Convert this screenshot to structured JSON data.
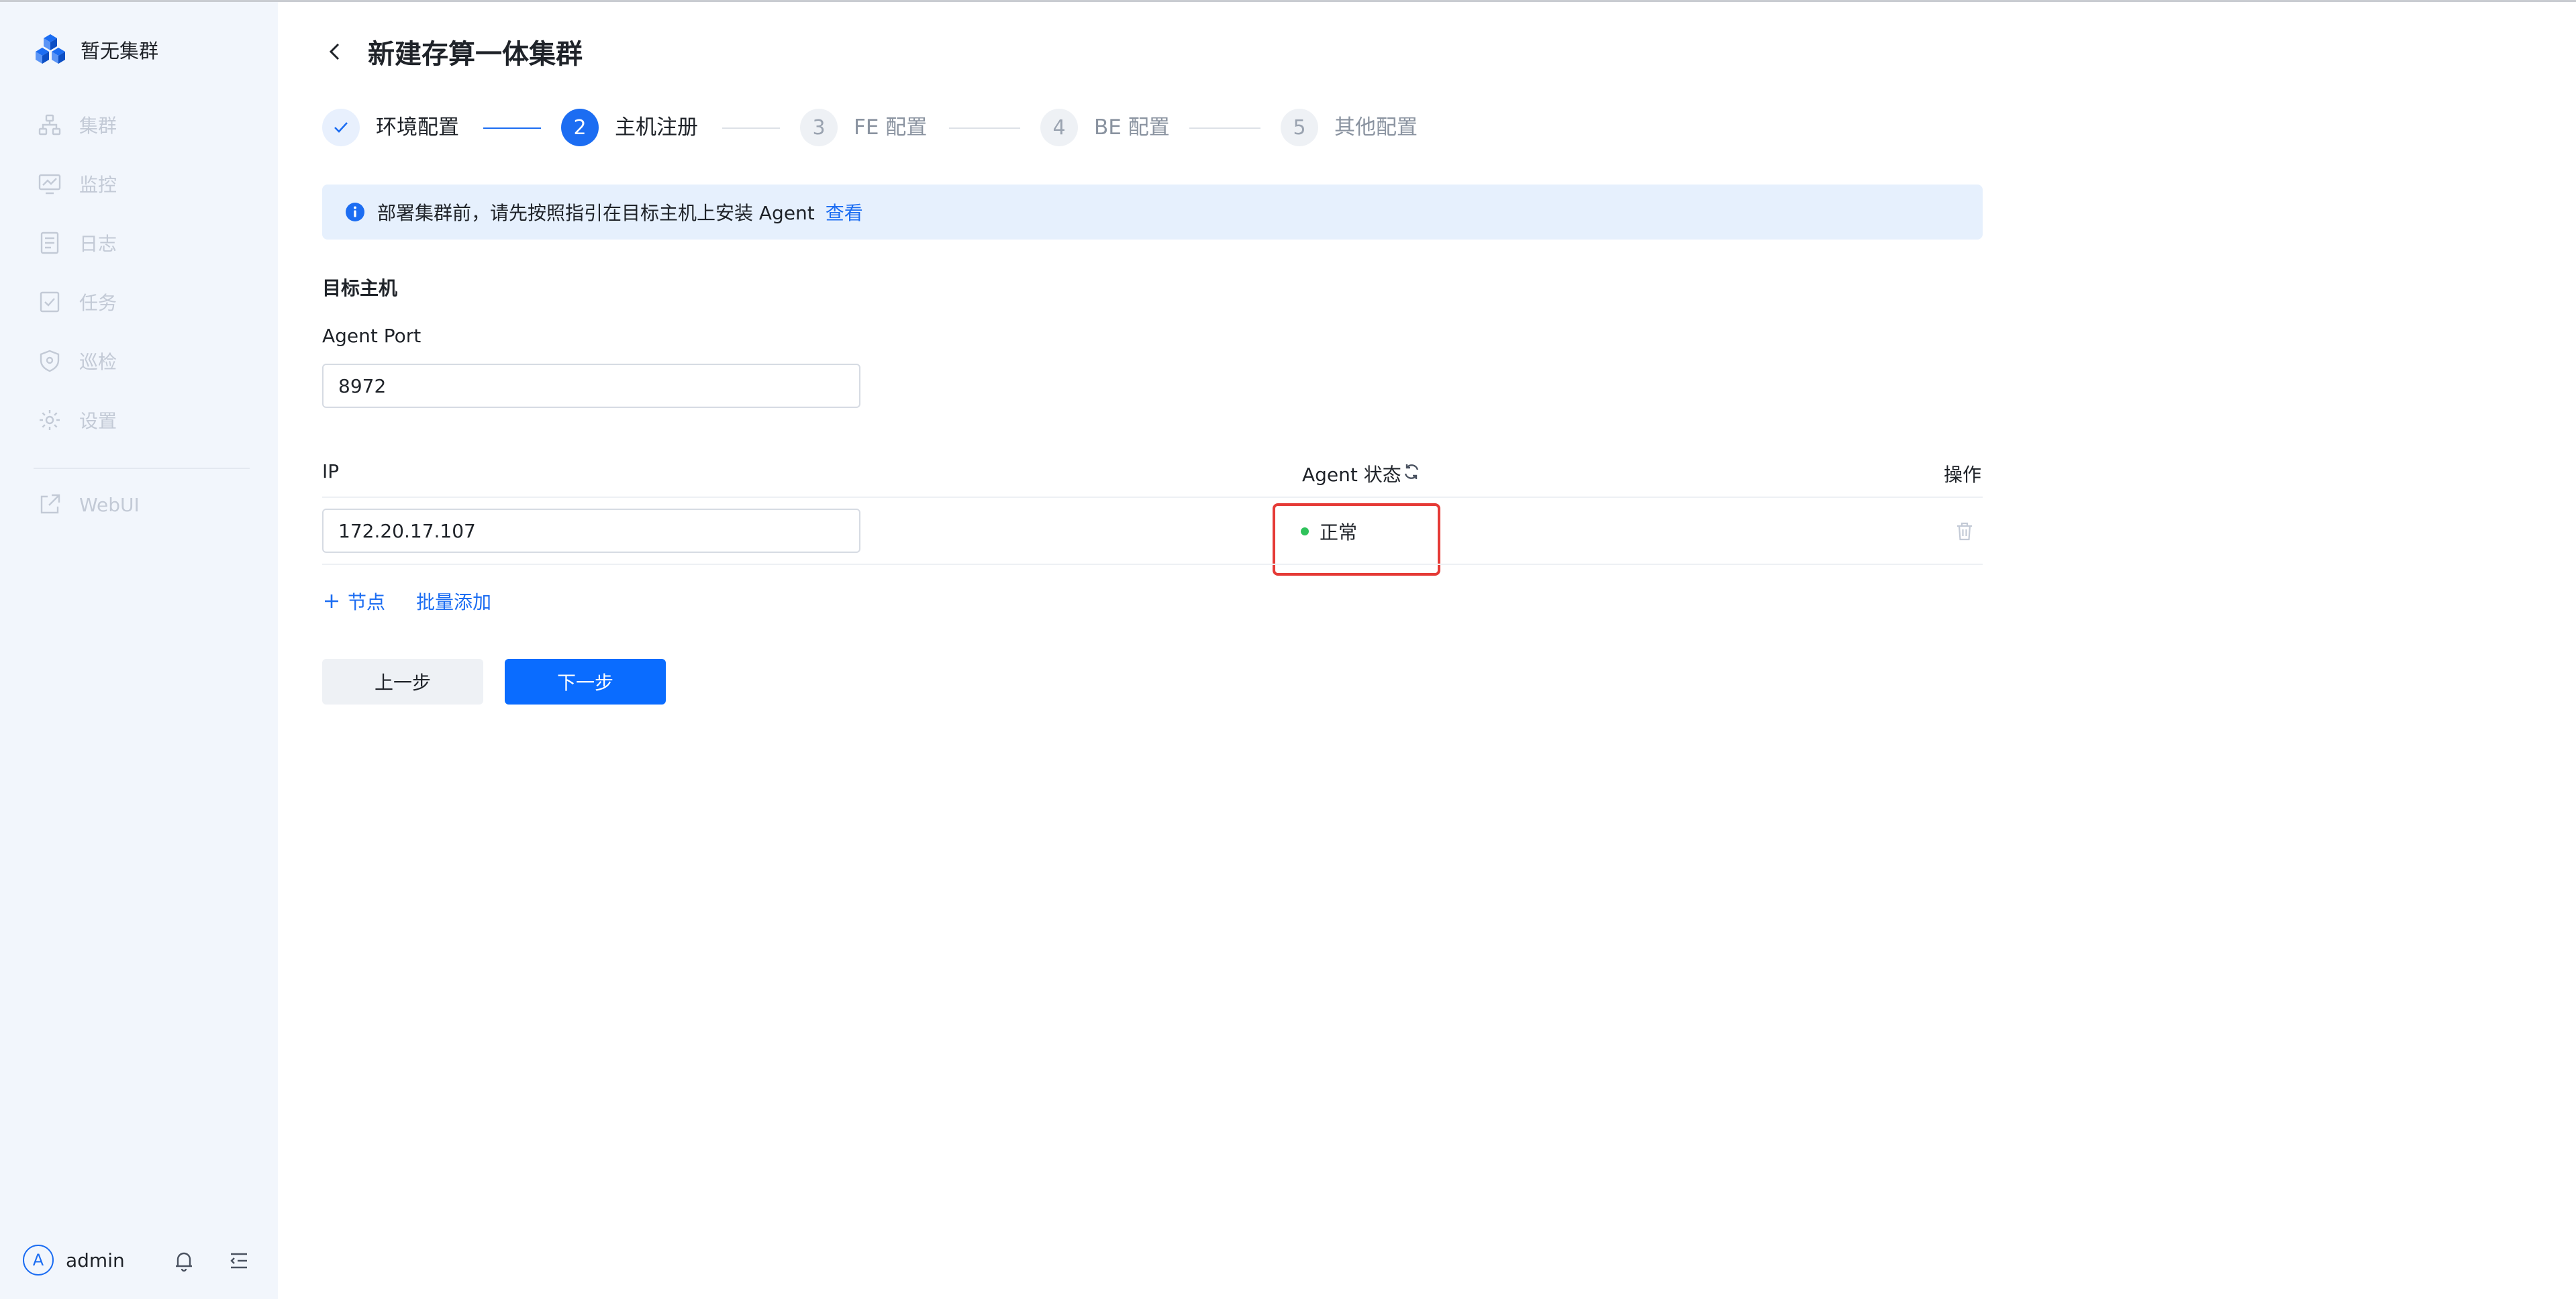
{
  "app": {
    "cluster_name": "暂无集群"
  },
  "sidebar": {
    "items": [
      {
        "label": "集群",
        "icon": "cluster-icon"
      },
      {
        "label": "监控",
        "icon": "monitor-icon"
      },
      {
        "label": "日志",
        "icon": "log-icon"
      },
      {
        "label": "任务",
        "icon": "task-icon"
      },
      {
        "label": "巡检",
        "icon": "inspection-icon"
      },
      {
        "label": "设置",
        "icon": "gear-icon"
      },
      {
        "label": "WebUI",
        "icon": "external-link-icon"
      }
    ],
    "user": {
      "avatar_letter": "A",
      "name": "admin"
    }
  },
  "page": {
    "title": "新建存算一体集群"
  },
  "steps": [
    {
      "label": "环境配置",
      "state": "done"
    },
    {
      "number": "2",
      "label": "主机注册",
      "state": "active"
    },
    {
      "number": "3",
      "label": "FE 配置",
      "state": "wait"
    },
    {
      "number": "4",
      "label": "BE 配置",
      "state": "wait"
    },
    {
      "number": "5",
      "label": "其他配置",
      "state": "wait"
    }
  ],
  "alert": {
    "text": "部署集群前，请先按照指引在目标主机上安装 Agent",
    "link": "查看"
  },
  "form": {
    "section_title": "目标主机",
    "agent_port_label": "Agent Port",
    "agent_port_value": "8972"
  },
  "table": {
    "headers": {
      "ip": "IP",
      "status": "Agent 状态",
      "action": "操作"
    },
    "rows": [
      {
        "ip": "172.20.17.107",
        "status": "正常"
      }
    ]
  },
  "actions": {
    "add_node": "节点",
    "batch_add": "批量添加",
    "prev": "上一步",
    "next": "下一步"
  },
  "colors": {
    "accent": "#1c6df2",
    "status_ok": "#2fc25b",
    "highlight": "#e53a36"
  }
}
